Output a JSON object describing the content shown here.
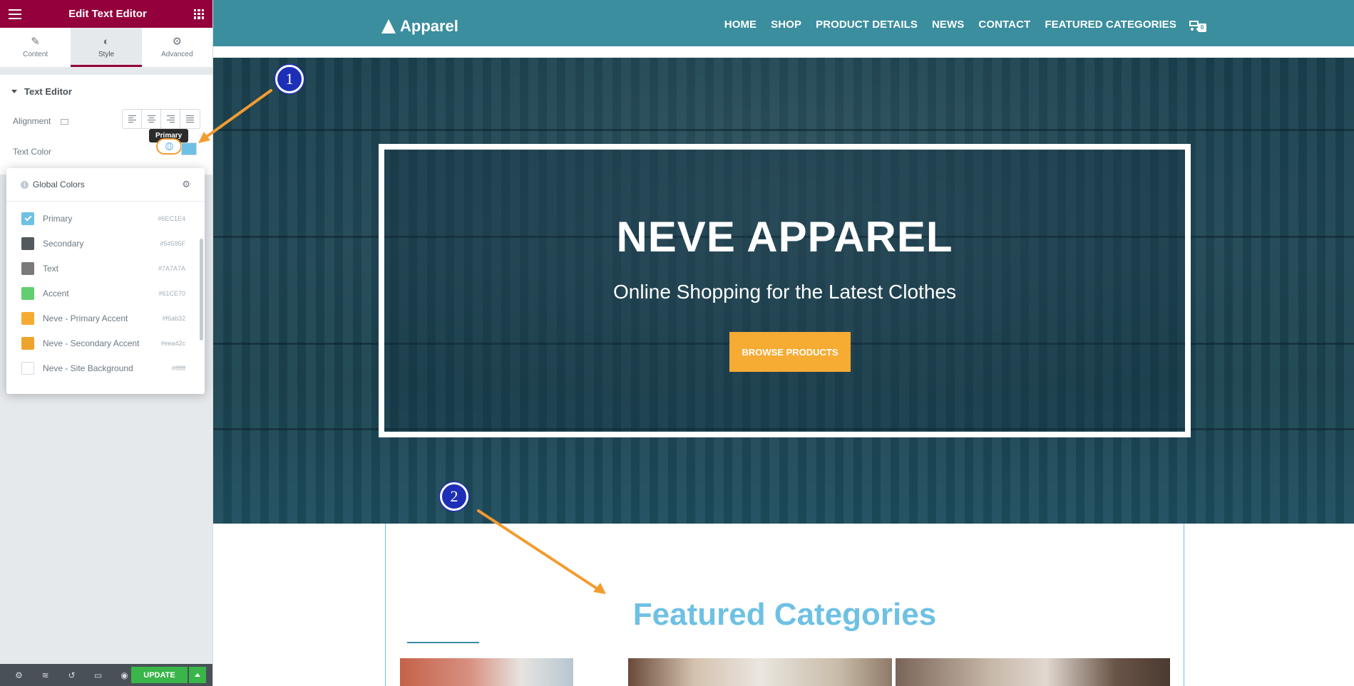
{
  "panel": {
    "title": "Edit Text Editor",
    "tabs": [
      {
        "label": "Content",
        "icon": "pencil-icon"
      },
      {
        "label": "Style",
        "icon": "contrast-icon"
      },
      {
        "label": "Advanced",
        "icon": "gear-icon"
      }
    ],
    "section_title": "Text Editor",
    "alignment_label": "Alignment",
    "text_color_label": "Text Color",
    "tooltip": "Primary",
    "selected_color": "#6EC1E4"
  },
  "global_colors": {
    "title": "Global Colors",
    "items": [
      {
        "name": "Primary",
        "hex": "#6EC1E4",
        "color": "#6EC1E4",
        "selected": true
      },
      {
        "name": "Secondary",
        "hex": "#54595F",
        "color": "#54595F"
      },
      {
        "name": "Text",
        "hex": "#7A7A7A",
        "color": "#7A7A7A"
      },
      {
        "name": "Accent",
        "hex": "#61CE70",
        "color": "#61CE70"
      },
      {
        "name": "Neve - Primary Accent",
        "hex": "#f6ab32",
        "color": "#f6ab32"
      },
      {
        "name": "Neve - Secondary Accent",
        "hex": "#eea42c",
        "color": "#eea42c"
      },
      {
        "name": "Neve - Site Background",
        "hex": "#ffffff",
        "color": "#ffffff"
      }
    ]
  },
  "footer": {
    "update_label": "UPDATE"
  },
  "site": {
    "logo": "Apparel",
    "nav": [
      "HOME",
      "SHOP",
      "PRODUCT DETAILS",
      "NEWS",
      "CONTACT",
      "FEATURED CATEGORIES"
    ],
    "cart_count": "0",
    "hero_title": "NEVE APPAREL",
    "hero_subtitle": "Online Shopping for the Latest Clothes",
    "hero_button": "BROWSE PRODUCTS",
    "featured_title": "Featured Categories"
  },
  "annotations": {
    "badge1": "1",
    "badge2": "2",
    "arrow_color": "#f29c30"
  }
}
